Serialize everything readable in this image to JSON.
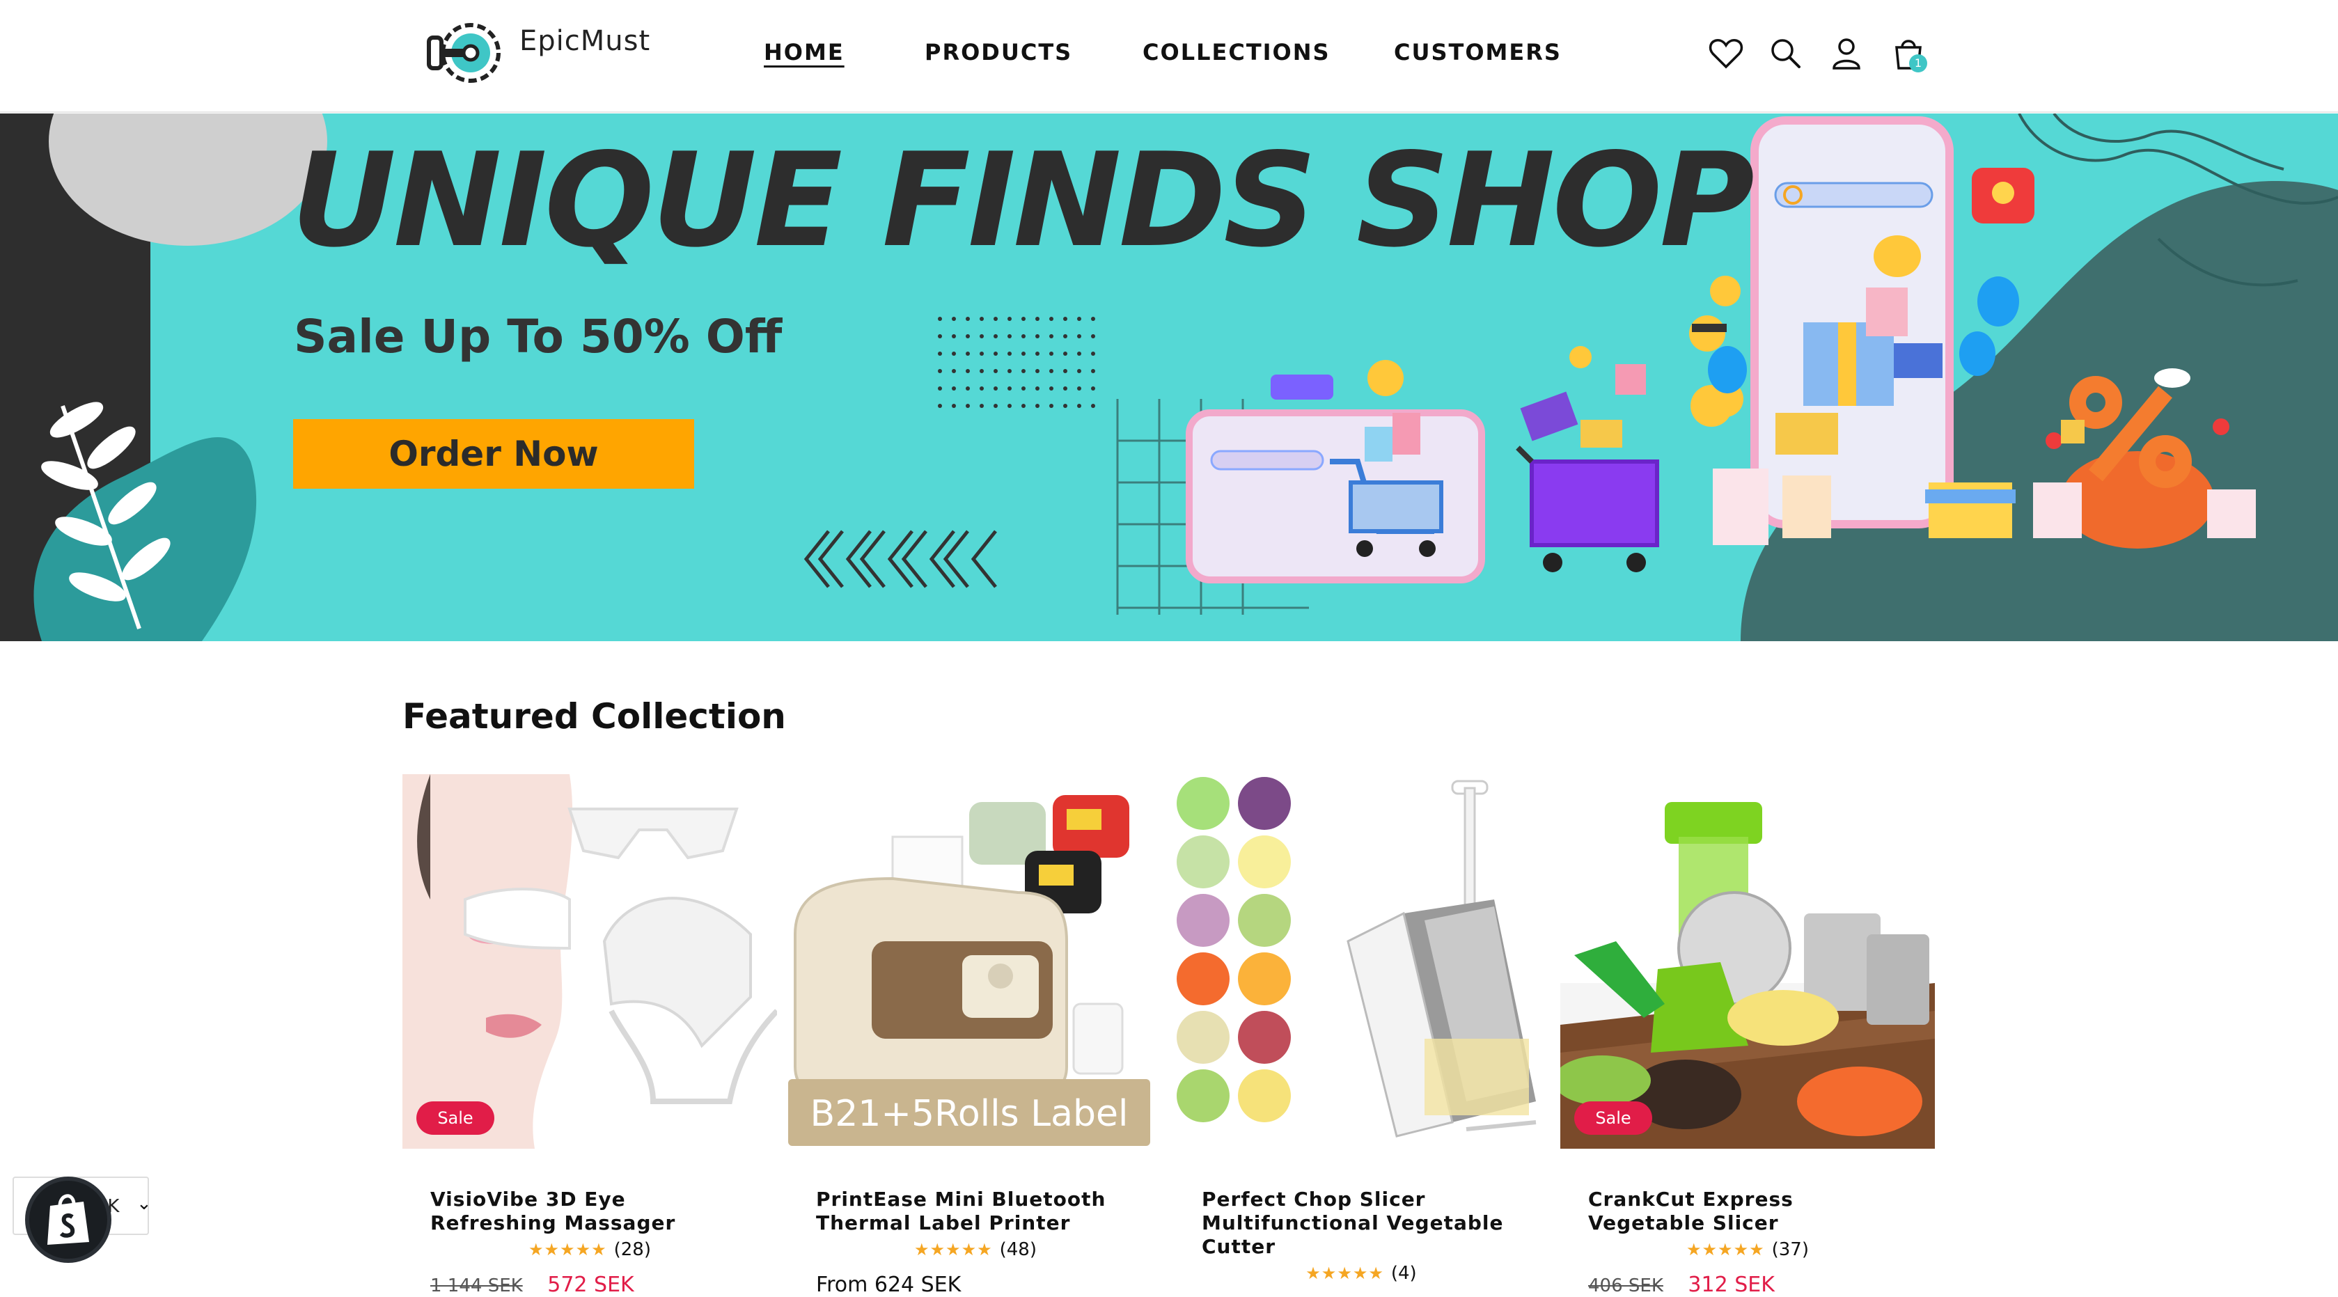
{
  "header": {
    "logo_text": "EpicMust",
    "nav": [
      {
        "label": "HOME",
        "active": true
      },
      {
        "label": "PRODUCTS",
        "active": false
      },
      {
        "label": "COLLECTIONS",
        "active": false
      },
      {
        "label": "CUSTOMERS",
        "active": false
      }
    ],
    "icons": [
      "heart-icon",
      "search-icon",
      "account-icon",
      "cart-icon"
    ],
    "cart_count": "1"
  },
  "hero": {
    "title": "UNIQUE FINDS SHOP",
    "subtitle": "Sale Up To 50% Off",
    "cta_label": "Order Now",
    "colors": {
      "background": "#55d8d5",
      "cta": "#ffa500",
      "dark_panel": "#2e2e2e",
      "teal_blob": "#3f6f6e"
    }
  },
  "featured": {
    "title": "Featured Collection",
    "products": [
      {
        "name": "VisioVibe 3D Eye Refreshing Massager",
        "sale_badge": "Sale",
        "stars": "★★★★★",
        "review_count": "(28)",
        "old_price": "1 144 SEK",
        "price": "572 SEK"
      },
      {
        "name": "PrintEase Mini Bluetooth Thermal Label Printer",
        "image_caption": "B21+5Rolls Label",
        "stars": "★★★★★",
        "review_count": "(48)",
        "price": "From 624 SEK"
      },
      {
        "name": "Perfect Chop Slicer Multifunctional Vegetable Cutter",
        "stars": "★★★★★",
        "review_count": "(4)"
      },
      {
        "name": "CrankCut Express Vegetable Slicer",
        "sale_badge": "Sale",
        "stars": "★★★★★",
        "review_count": "(37)",
        "old_price": "406 SEK",
        "price": "312 SEK"
      }
    ]
  },
  "widget": {
    "currency_code": "EK",
    "chevron": "⌄"
  },
  "colors": {
    "sale": "#e11d48",
    "star": "#f5a623"
  }
}
